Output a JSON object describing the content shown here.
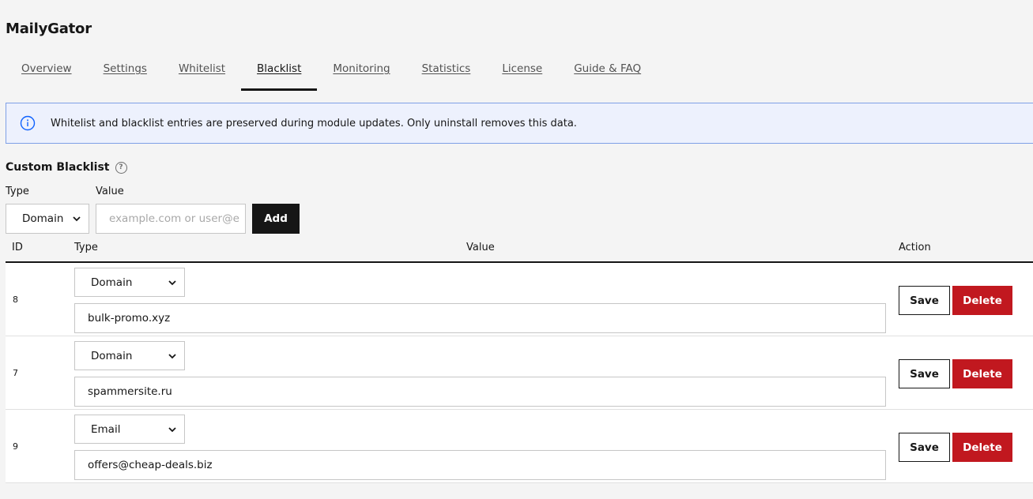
{
  "app": {
    "title": "MailyGator"
  },
  "tabs": [
    {
      "label": "Overview"
    },
    {
      "label": "Settings"
    },
    {
      "label": "Whitelist"
    },
    {
      "label": "Blacklist",
      "active": true
    },
    {
      "label": "Monitoring"
    },
    {
      "label": "Statistics"
    },
    {
      "label": "License"
    },
    {
      "label": "Guide & FAQ"
    }
  ],
  "notice": {
    "icon": "info-circle-icon",
    "text": "Whitelist and blacklist entries are preserved during module updates. Only uninstall removes this data."
  },
  "section": {
    "title": "Custom Blacklist",
    "help_icon": "?"
  },
  "add_form": {
    "type_label": "Type",
    "value_label": "Value",
    "type_selected": "Domain",
    "value_placeholder": "example.com or user@e",
    "add_label": "Add"
  },
  "table": {
    "columns": [
      "ID",
      "Type",
      "Value",
      "Action"
    ],
    "rows": [
      {
        "id": "8",
        "type": "Domain",
        "value": "bulk-promo.xyz"
      },
      {
        "id": "7",
        "type": "Domain",
        "value": "spammersite.ru"
      },
      {
        "id": "9",
        "type": "Email",
        "value": "offers@cheap-deals.biz"
      }
    ],
    "save_label": "Save",
    "delete_label": "Delete"
  },
  "colors": {
    "accent_dark": "#161616",
    "danger": "#c1181f",
    "notice_bg": "#edf1fd",
    "notice_border": "#7fa0e6",
    "info_icon": "#0f62fe"
  }
}
